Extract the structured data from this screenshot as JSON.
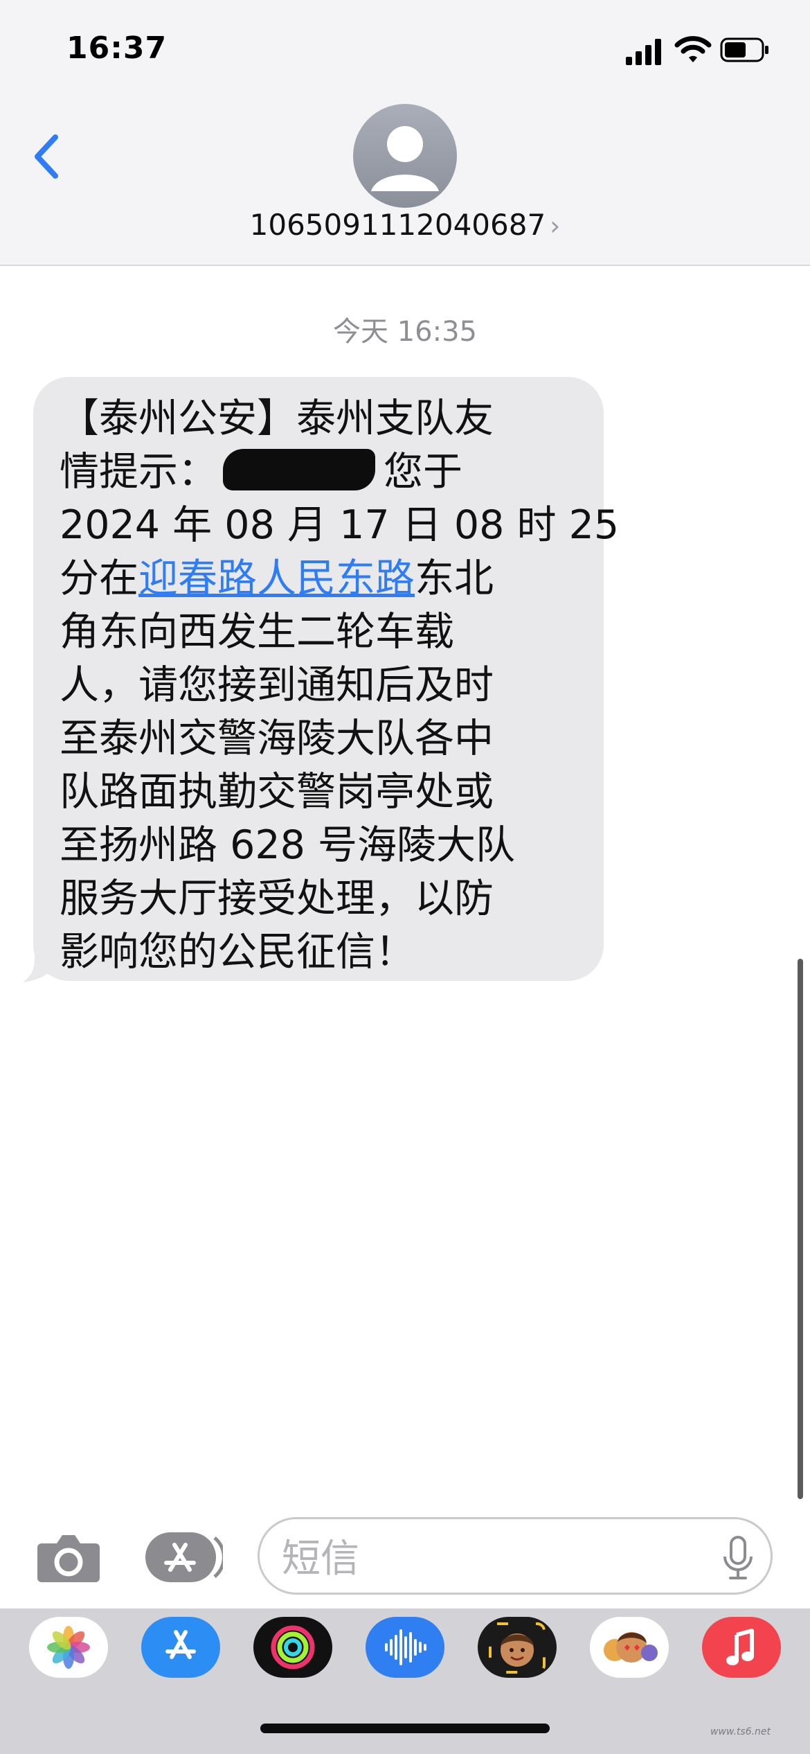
{
  "status_bar": {
    "time": "16:37"
  },
  "header": {
    "contact_number": "1065091112040687",
    "chevron": "›"
  },
  "conversation": {
    "timestamp": "今天 16:35",
    "message": {
      "line1": "【泰州公安】泰州支队友",
      "line2_prefix": "情提示：",
      "line2_suffix": "您于",
      "line3": "2024 年 08 月 17 日 08 时 25",
      "line4_prefix": "分在",
      "link_text": "迎春路人民东路",
      "line4_suffix": "东北",
      "line5": "角东向西发生二轮车载",
      "line6": "人，请您接到通知后及时",
      "line7": "至泰州交警海陵大队各中",
      "line8": "队路面执勤交警岗亭处或",
      "line9": "至扬州路 628 号海陵大队",
      "line10": "服务大厅接受处理，以防",
      "line11": "影响您的公民征信！"
    }
  },
  "input_bar": {
    "placeholder": "短信"
  },
  "icons": {
    "back": "chevron-left-icon",
    "avatar": "person-icon",
    "camera": "camera-icon",
    "apps": "app-store-icon",
    "mic": "microphone-icon"
  },
  "colors": {
    "link": "#2e7cf6",
    "back_button": "#2f7cf6",
    "bubble": "#e9e9eb",
    "music_app": "#f2434f",
    "app_store": "#2c8df5"
  },
  "watermark": "www.ts6.net"
}
